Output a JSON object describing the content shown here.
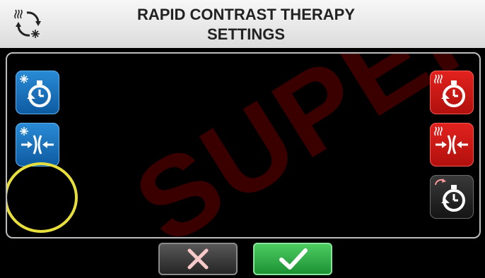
{
  "header": {
    "title_line1": "RAPID CONTRAST THERAPY",
    "title_line2": "SETTINGS",
    "icon": "hot-cold-cycle-icon"
  },
  "watermark": "SUPER",
  "left_tiles": [
    {
      "name": "cold-timer-button",
      "icon": "snowflake-timer-icon"
    },
    {
      "name": "cold-compression-button",
      "icon": "snowflake-compression-icon",
      "highlighted": true
    }
  ],
  "right_tiles": [
    {
      "name": "heat-timer-button",
      "icon": "heat-timer-icon"
    },
    {
      "name": "heat-compression-button",
      "icon": "heat-compression-icon"
    },
    {
      "name": "cycle-timer-button",
      "icon": "cycle-timer-icon"
    }
  ],
  "buttons": [
    {
      "name": "cancel-button",
      "icon": "x-icon"
    },
    {
      "name": "confirm-button",
      "icon": "checkmark-icon"
    }
  ],
  "colors": {
    "cold": "#1a73c2",
    "heat": "#d41a17",
    "confirm": "#2db347",
    "highlight": "#e8df3c"
  }
}
